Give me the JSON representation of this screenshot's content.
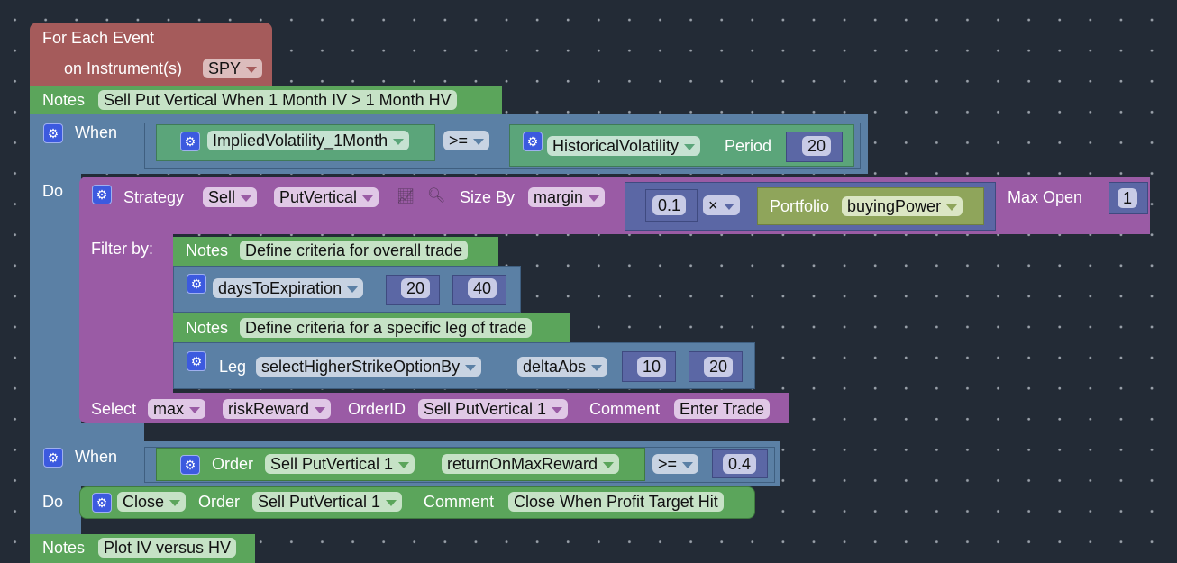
{
  "event": {
    "title": "For Each Event",
    "instrument_label": "on Instrument(s)",
    "instrument": "SPY"
  },
  "notes1": {
    "label": "Notes",
    "text": "Sell Put Vertical When 1 Month IV > 1 Month HV"
  },
  "when1": {
    "when_label": "When",
    "do_label": "Do",
    "left": "ImpliedVolatility_1Month",
    "op": ">=",
    "right": "HistoricalVolatility",
    "period_label": "Period",
    "period": "20"
  },
  "strategy": {
    "label": "Strategy",
    "side": "Sell",
    "type": "PutVertical",
    "size_by_label": "Size By",
    "size_by": "margin",
    "factor": "0.1",
    "mult_op": "×",
    "portfolio_label": "Portfolio",
    "portfolio_field": "buyingPower",
    "max_open_label": "Max Open",
    "max_open": "1",
    "filter_label": "Filter by:",
    "notes2": {
      "label": "Notes",
      "text": "Define criteria for overall trade"
    },
    "dte": {
      "field": "daysToExpiration",
      "min": "20",
      "max": "40"
    },
    "notes3": {
      "label": "Notes",
      "text": "Define criteria for a specific leg of trade"
    },
    "leg": {
      "label": "Leg",
      "selector": "selectHigherStrikeOptionBy",
      "metric": "deltaAbs",
      "min": "10",
      "max": "20"
    },
    "select": {
      "label": "Select",
      "agg": "max",
      "metric": "riskReward",
      "order_id_label": "OrderID",
      "order_id": "Sell PutVertical 1",
      "comment_label": "Comment",
      "comment": "Enter Trade"
    }
  },
  "when2": {
    "when_label": "When",
    "do_label": "Do",
    "order_label": "Order",
    "order": "Sell PutVertical 1",
    "metric": "returnOnMaxReward",
    "op": ">=",
    "value": "0.4",
    "action": "Close",
    "action_order_label": "Order",
    "action_order": "Sell PutVertical 1",
    "comment_label": "Comment",
    "comment": "Close When Profit Target Hit"
  },
  "notes4": {
    "label": "Notes",
    "text": "Plot IV versus HV"
  },
  "colors": {
    "event": "#a55b5b",
    "notes": "#5ba55b",
    "logic": "#5b80a5",
    "strategy": "#9a5ba5",
    "indicator": "#5ba57a",
    "math": "#5b67a5",
    "portfolio": "#8fa55b"
  }
}
